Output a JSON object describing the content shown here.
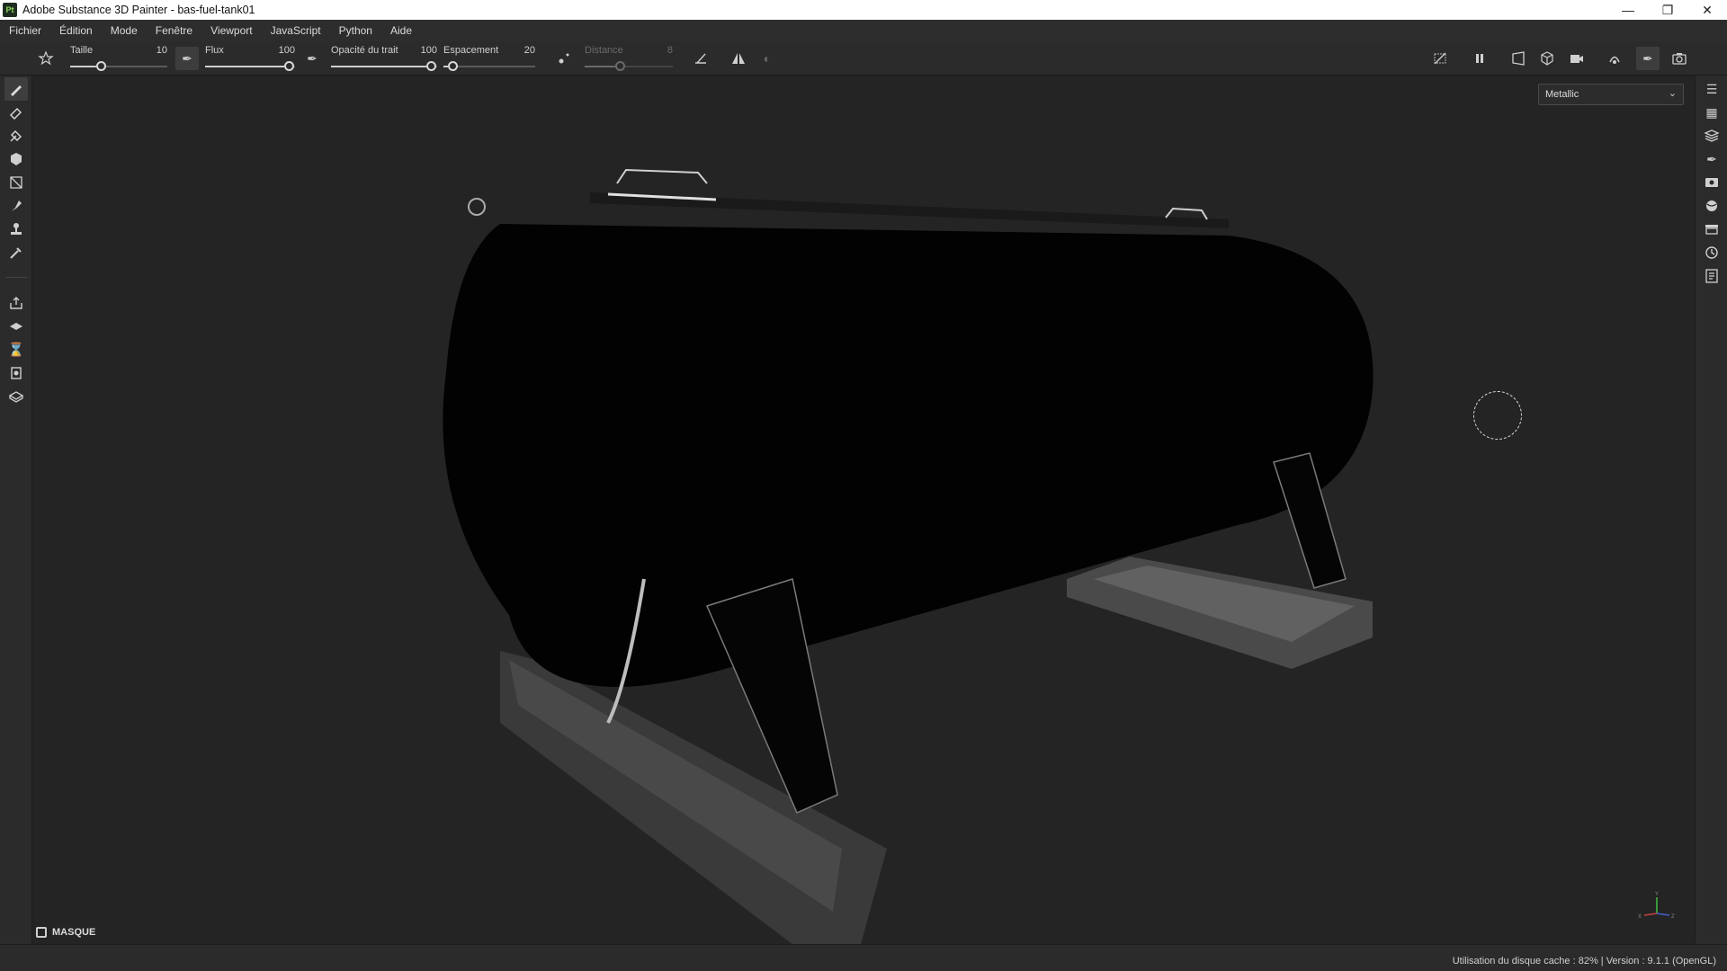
{
  "window": {
    "app_logo": "Pt",
    "title": "Adobe Substance 3D Painter - bas-fuel-tank01",
    "controls": [
      "minimize-icon",
      "maximize-icon",
      "close-icon"
    ]
  },
  "menu": [
    "Fichier",
    "Édition",
    "Mode",
    "Fenêtre",
    "Viewport",
    "JavaScript",
    "Python",
    "Aide"
  ],
  "toolbar": {
    "params": [
      {
        "label": "Taille",
        "value": "10",
        "level": 0.3
      },
      {
        "label": "Flux",
        "value": "100",
        "level": 1.0
      },
      {
        "label": "Opacité du trait",
        "value": "100",
        "level": 1.0
      },
      {
        "label": "Espacement",
        "value": "20",
        "level": 0.05
      },
      {
        "label": "Distance",
        "value": "8",
        "level": 0.4,
        "disabled": true
      }
    ],
    "right_icons": [
      "hide-icon",
      "pause-icon",
      "perspective-icon",
      "cube-icon",
      "camera-icon",
      "symmetry-icon",
      "paint-mode-icon",
      "screenshot-icon"
    ]
  },
  "left_tools": [
    "paint-brush-icon",
    "eraser-icon",
    "projection-icon",
    "polygon-fill-icon",
    "geometry-mask-icon",
    "smudge-icon",
    "clone-icon",
    "color-picker-icon",
    "export-icon",
    "bake-icon",
    "shelf-icon",
    "texture-set-icon",
    "mesh-icon"
  ],
  "right_tools": [
    "layers-icon",
    "texture-set-list-icon",
    "layer-stack-icon",
    "properties-icon",
    "display-settings-icon",
    "environment-icon",
    "shelf-icon",
    "history-icon",
    "log-icon"
  ],
  "viewport": {
    "channel": "Metallic",
    "mask_label": "MASQUE",
    "gizmo_axes": [
      "X",
      "Y",
      "Z"
    ]
  },
  "status": {
    "text": "Utilisation du disque cache : 82% | Version : 9.1.1 (OpenGL)"
  }
}
